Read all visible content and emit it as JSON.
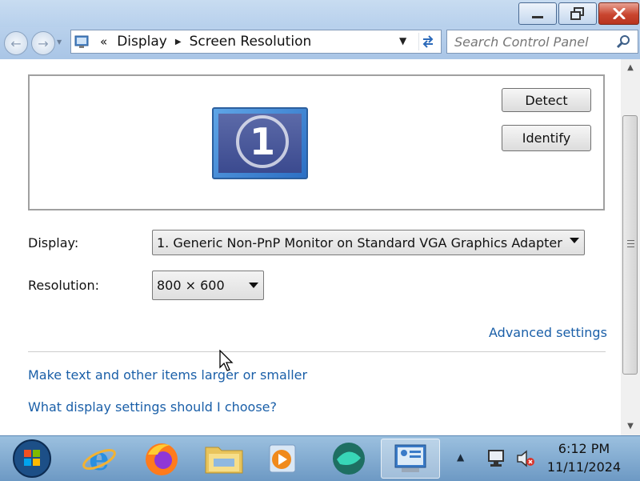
{
  "window": {
    "minimize_label": "minimize",
    "maximize_label": "restore",
    "close_label": "close"
  },
  "nav": {
    "overflow_chevron": "«",
    "breadcrumbs": [
      "Display",
      "Screen Resolution"
    ],
    "search_placeholder": "Search Control Panel"
  },
  "preview": {
    "monitor_number": "1",
    "detect_label": "Detect",
    "identify_label": "Identify"
  },
  "settings": {
    "display_label": "Display:",
    "display_value": "1. Generic Non-PnP Monitor on Standard VGA Graphics Adapter",
    "resolution_label": "Resolution:",
    "resolution_value": "800 × 600",
    "advanced_link": "Advanced settings"
  },
  "links": {
    "text_size": "Make text and other items larger or smaller",
    "what_settings": "What display settings should I choose?"
  },
  "taskbar": {
    "pinned_icons": [
      "start-orb-icon",
      "internet-explorer-icon",
      "firefox-icon",
      "file-explorer-icon",
      "media-player-icon",
      "aqua-app-icon",
      "control-panel-icon"
    ],
    "active_icon": "control-panel-icon",
    "time": "6:12 PM",
    "date": "11/11/2024"
  },
  "colors": {
    "link": "#1a5fa8",
    "taskbar": "#8cb3d8",
    "titlebar": "#c1d7ef"
  }
}
